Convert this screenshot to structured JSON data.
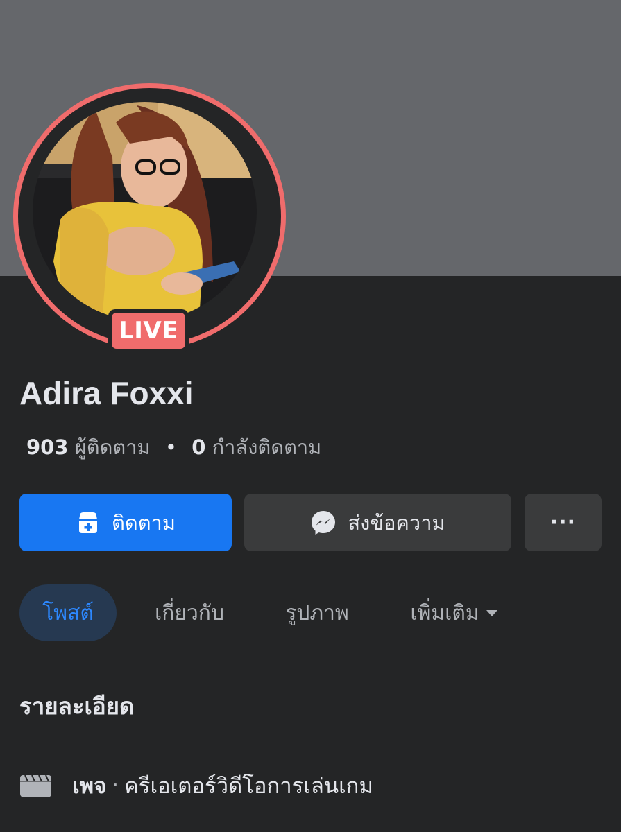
{
  "profile": {
    "name": "Adira Foxxi",
    "live_label": "LIVE",
    "followers_count": "903",
    "followers_label": "ผู้ติดตาม",
    "following_count": "0",
    "following_label": "กำลังติดตาม",
    "stats_separator": "•"
  },
  "actions": {
    "follow_label": "ติดตาม",
    "message_label": "ส่งข้อความ",
    "more_label": "···"
  },
  "tabs": [
    {
      "label": "โพสต์",
      "active": true
    },
    {
      "label": "เกี่ยวกับ",
      "active": false
    },
    {
      "label": "รูปภาพ",
      "active": false
    },
    {
      "label": "เพิ่มเติม",
      "active": false
    }
  ],
  "details": {
    "title": "รายละเอียด",
    "page_label": "เพจ",
    "separator": "·",
    "category": "ครีเอเตอร์วิดีโอการเล่นเกม"
  },
  "colors": {
    "background": "#242526",
    "cover": "#65676b",
    "live_ring": "#f06c6c",
    "primary": "#1877f2",
    "secondary_button": "#3a3b3c",
    "active_tab_bg": "#263951",
    "active_tab_text": "#2d88ff"
  },
  "icons": {
    "follow": "follow-page-icon",
    "message": "messenger-icon",
    "more_tabs": "caret-down-icon",
    "page": "page-flag-icon"
  }
}
